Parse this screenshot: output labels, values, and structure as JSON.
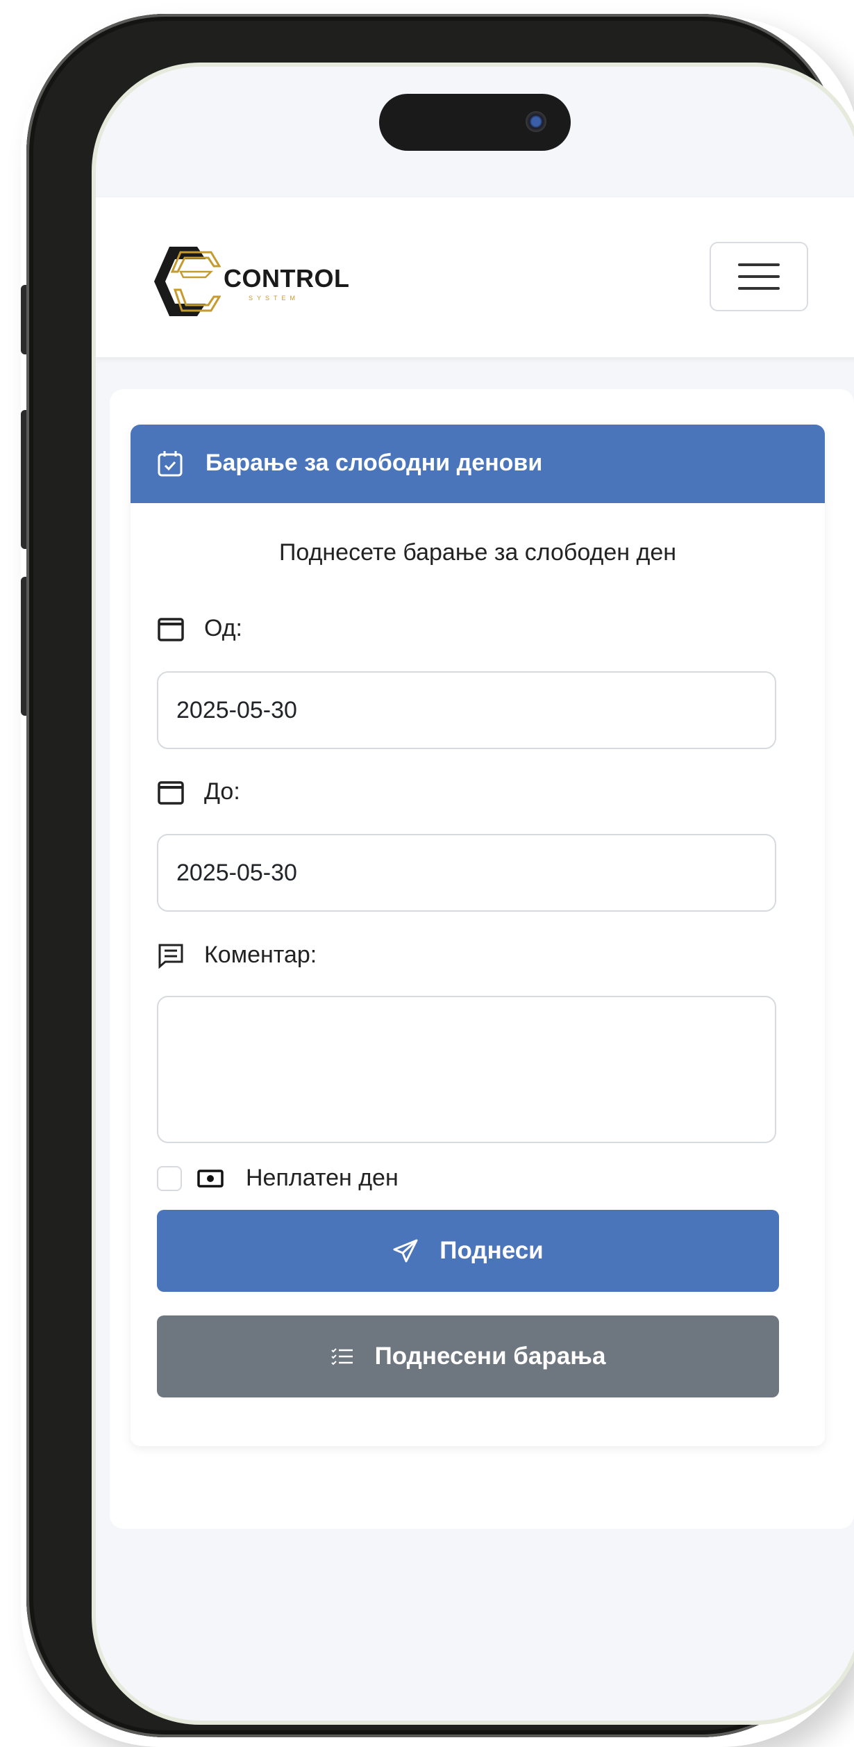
{
  "brand": {
    "name": "CONTROL",
    "tagline": "SYSTEM"
  },
  "navbar": {
    "menu_icon": "hamburger-menu-icon"
  },
  "form": {
    "header_title": "Барање за слободни денови",
    "header_icon": "calendar-check-icon",
    "subtitle": "Поднесете барање за слободен ден",
    "from_label": "Од:",
    "from_value": "2025-05-30",
    "to_label": "До:",
    "to_value": "2025-05-30",
    "comment_label": "Коментар:",
    "comment_value": "",
    "unpaid_label": "Неплатен ден",
    "submit_label": "Поднеси",
    "submitted_label": "Поднесени барања"
  },
  "colors": {
    "primary": "#4b75ba",
    "secondary": "#6e7680",
    "accent_gold": "#c69a2d"
  }
}
